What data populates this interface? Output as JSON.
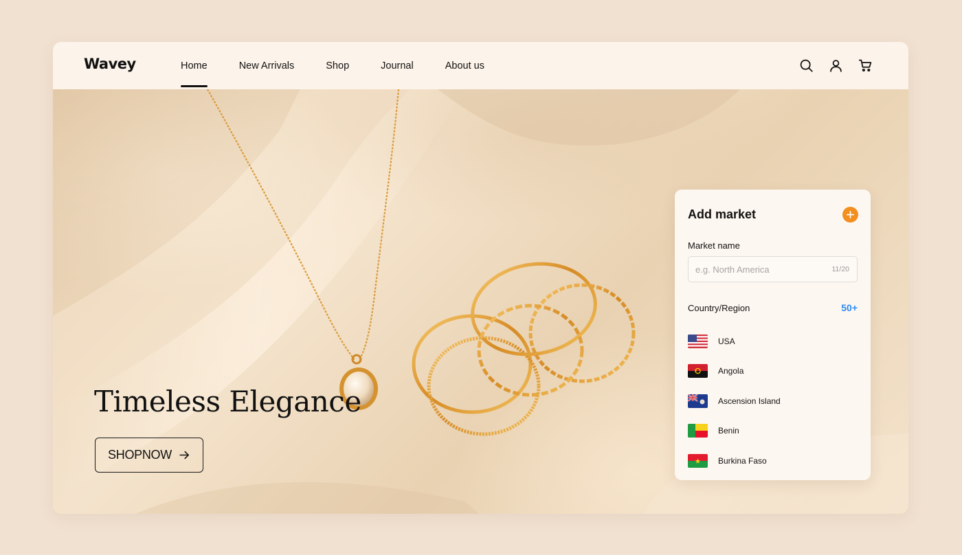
{
  "brand": {
    "name": "Wavey"
  },
  "nav": {
    "links": [
      {
        "label": "Home",
        "active": true
      },
      {
        "label": "New Arrivals",
        "active": false
      },
      {
        "label": "Shop",
        "active": false
      },
      {
        "label": "Journal",
        "active": false
      },
      {
        "label": "About us",
        "active": false
      }
    ],
    "icons": [
      "search-icon",
      "user-icon",
      "cart-icon"
    ]
  },
  "hero": {
    "title": "Timeless Elegance",
    "cta_label": "SHOPNOW",
    "cta_icon": "arrow-right-icon"
  },
  "market_card": {
    "title": "Add market",
    "add_icon": "plus-icon",
    "accent_color": "#f28f1f",
    "name_label": "Market name",
    "name_placeholder": "e.g. North America",
    "name_counter": "11/20",
    "region_label": "Country/Region",
    "region_count": "50+",
    "region_count_color": "#2d8cf0",
    "countries": [
      {
        "name": "USA",
        "flag": "us-flag"
      },
      {
        "name": "Angola",
        "flag": "angola-flag"
      },
      {
        "name": "Ascension Island",
        "flag": "ascension-flag"
      },
      {
        "name": "Benin",
        "flag": "benin-flag"
      },
      {
        "name": "Burkina Faso",
        "flag": "burkina-faso-flag"
      }
    ]
  }
}
